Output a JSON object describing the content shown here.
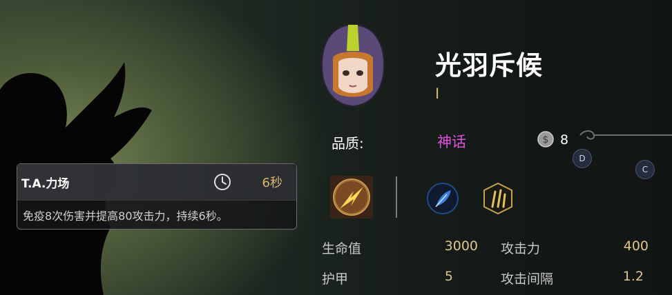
{
  "tooltip": {
    "name": "T.A.力场",
    "cooldown": "6秒",
    "description": "免疫8次伤害并提高80攻击力，持续6秒。"
  },
  "unit": {
    "name": "光羽斥候",
    "race": "Ⅰ"
  },
  "quality": {
    "label": "品质:",
    "value": "神话",
    "value_color": "#e44fe0"
  },
  "cost": "8",
  "badges": {
    "d": "D",
    "c": "C"
  },
  "stats": {
    "hp_label": "生命值",
    "hp_value": "3000",
    "atk_label": "攻击力",
    "atk_value": "400",
    "armor_label": "护甲",
    "armor_value": "5",
    "interval_label": "攻击间隔",
    "interval_value": "1.2"
  },
  "icons": {
    "skill": "shield-burst-icon",
    "trait1": "feather-icon",
    "trait2": "claw-icon",
    "cooldown": "clock-icon",
    "coin": "coin-icon"
  }
}
